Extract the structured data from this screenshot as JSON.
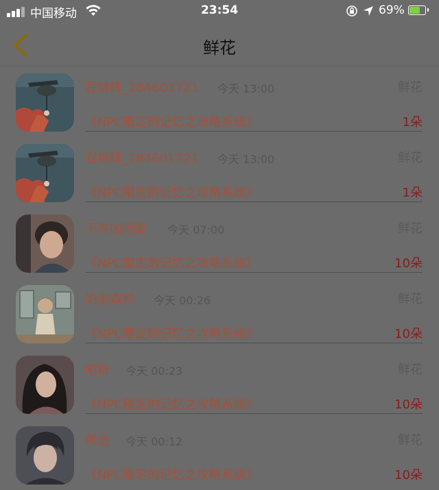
{
  "status_bar": {
    "carrier": "中国移动",
    "time": "23:54",
    "battery_percent": "69%",
    "battery_level": 0.69
  },
  "nav": {
    "title": "鲜花"
  },
  "records": [
    {
      "name": "程锦辉_284601721",
      "time": "今天 13:00",
      "type": "鲜花",
      "book": "《NPC限定的记忆之攻略系统》",
      "count": "1朵"
    },
    {
      "name": "程锦辉_284601721",
      "time": "今天 13:00",
      "type": "鲜花",
      "book": "《NPC限定的记忆之攻略系统》",
      "count": "1朵"
    },
    {
      "name": "不许凶阿粟",
      "time": "今天 07:00",
      "type": "鲜花",
      "book": "《NPC限定的记忆之攻略系统》",
      "count": "10朵"
    },
    {
      "name": "奶泡森鸭",
      "time": "今天 00:26",
      "type": "鲜花",
      "book": "《NPC限定的记忆之攻略系统》",
      "count": "10朵"
    },
    {
      "name": "昭析",
      "time": "今天 00:23",
      "type": "鲜花",
      "book": "《NPC限定的记忆之攻略系统》",
      "count": "10朵"
    },
    {
      "name": "稀丞",
      "time": "今天 00:12",
      "type": "鲜花",
      "book": "《NPC限定的记忆之攻略系统》",
      "count": "10朵"
    }
  ],
  "icons": {
    "back": "chevron-left-icon",
    "wifi": "wifi-icon",
    "lock": "rotation-lock-icon",
    "location": "location-arrow-icon",
    "battery": "battery-charging-icon"
  },
  "colors": {
    "name_text": "#a4513a",
    "count_text": "#8a1c1c",
    "back_chevron": "#8a6a10",
    "battery_fill": "#7ed13f"
  }
}
